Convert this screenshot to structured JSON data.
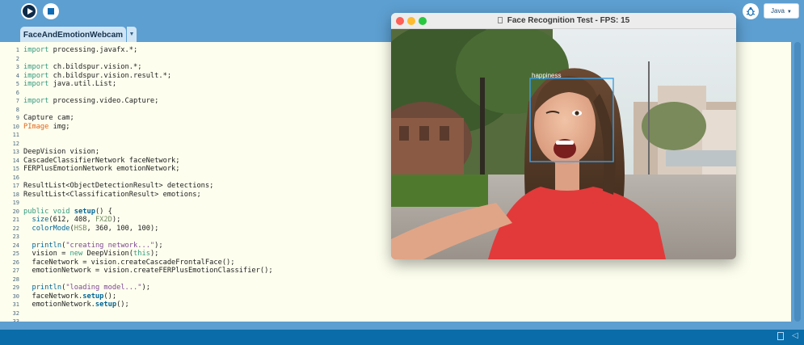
{
  "toolbar": {
    "run_icon": "play-icon",
    "stop_icon": "stop-icon",
    "debug_icon": "debugger-icon",
    "mode": "Java"
  },
  "tab": {
    "name": "FaceAndEmotionWebcam"
  },
  "editor": {
    "lines": [
      {
        "n": "1",
        "tokens": [
          {
            "t": "import",
            "c": "kw"
          },
          {
            "t": " processing.javafx.*;"
          }
        ]
      },
      {
        "n": "2",
        "tokens": []
      },
      {
        "n": "3",
        "tokens": [
          {
            "t": "import",
            "c": "kw"
          },
          {
            "t": " ch.bildspur.vision.*;"
          }
        ]
      },
      {
        "n": "4",
        "tokens": [
          {
            "t": "import",
            "c": "kw"
          },
          {
            "t": " ch.bildspur.vision.result.*;"
          }
        ]
      },
      {
        "n": "5",
        "tokens": [
          {
            "t": "import",
            "c": "kw"
          },
          {
            "t": " java.util.List;"
          }
        ]
      },
      {
        "n": "6",
        "tokens": []
      },
      {
        "n": "7",
        "tokens": [
          {
            "t": "import",
            "c": "kw"
          },
          {
            "t": " processing.video.Capture;"
          }
        ]
      },
      {
        "n": "8",
        "tokens": []
      },
      {
        "n": "9",
        "tokens": [
          {
            "t": "Capture cam;"
          }
        ]
      },
      {
        "n": "10",
        "tokens": [
          {
            "t": "PImage",
            "c": "ty"
          },
          {
            "t": " img;"
          }
        ]
      },
      {
        "n": "11",
        "tokens": []
      },
      {
        "n": "12",
        "tokens": []
      },
      {
        "n": "13",
        "tokens": [
          {
            "t": "DeepVision vision;"
          }
        ]
      },
      {
        "n": "14",
        "tokens": [
          {
            "t": "CascadeClassifierNetwork faceNetwork;"
          }
        ]
      },
      {
        "n": "15",
        "tokens": [
          {
            "t": "FERPlusEmotionNetwork emotionNetwork;"
          }
        ]
      },
      {
        "n": "16",
        "tokens": []
      },
      {
        "n": "17",
        "tokens": [
          {
            "t": "ResultList<ObjectDetectionResult> detections;"
          }
        ]
      },
      {
        "n": "18",
        "tokens": [
          {
            "t": "ResultList<ClassificationResult> emotions;"
          }
        ]
      },
      {
        "n": "19",
        "tokens": []
      },
      {
        "n": "20",
        "tokens": [
          {
            "t": "public void",
            "c": "kw"
          },
          {
            "t": " "
          },
          {
            "t": "setup",
            "c": "fn"
          },
          {
            "t": "() {"
          }
        ]
      },
      {
        "n": "21",
        "tokens": [
          {
            "t": "  "
          },
          {
            "t": "size",
            "c": "fn2"
          },
          {
            "t": "(612, 408, "
          },
          {
            "t": "FX2D",
            "c": "cst"
          },
          {
            "t": ");"
          }
        ]
      },
      {
        "n": "22",
        "tokens": [
          {
            "t": "  "
          },
          {
            "t": "colorMode",
            "c": "fn2"
          },
          {
            "t": "("
          },
          {
            "t": "HSB",
            "c": "cst"
          },
          {
            "t": ", 360, 100, 100);"
          }
        ]
      },
      {
        "n": "23",
        "tokens": []
      },
      {
        "n": "24",
        "tokens": [
          {
            "t": "  "
          },
          {
            "t": "println",
            "c": "fn2"
          },
          {
            "t": "("
          },
          {
            "t": "\"creating network...\"",
            "c": "str"
          },
          {
            "t": ");"
          }
        ]
      },
      {
        "n": "25",
        "tokens": [
          {
            "t": "  vision = "
          },
          {
            "t": "new",
            "c": "kw"
          },
          {
            "t": " DeepVision("
          },
          {
            "t": "this",
            "c": "this"
          },
          {
            "t": ");"
          }
        ]
      },
      {
        "n": "26",
        "tokens": [
          {
            "t": "  faceNetwork = vision.createCascadeFrontalFace();"
          }
        ]
      },
      {
        "n": "27",
        "tokens": [
          {
            "t": "  emotionNetwork = vision.createFERPlusEmotionClassifier();"
          }
        ]
      },
      {
        "n": "28",
        "tokens": []
      },
      {
        "n": "29",
        "tokens": [
          {
            "t": "  "
          },
          {
            "t": "println",
            "c": "fn2"
          },
          {
            "t": "("
          },
          {
            "t": "\"loading model...\"",
            "c": "str"
          },
          {
            "t": ");"
          }
        ]
      },
      {
        "n": "30",
        "tokens": [
          {
            "t": "  faceNetwork."
          },
          {
            "t": "setup",
            "c": "fn"
          },
          {
            "t": "();"
          }
        ]
      },
      {
        "n": "31",
        "tokens": [
          {
            "t": "  emotionNetwork."
          },
          {
            "t": "setup",
            "c": "fn"
          },
          {
            "t": "();"
          }
        ]
      },
      {
        "n": "32",
        "tokens": []
      },
      {
        "n": "33",
        "tokens": []
      }
    ]
  },
  "sketch_window": {
    "title": "Face Recognition Test - FPS: 15",
    "detection_label": "happiness",
    "box_color": "#3aa0e8"
  },
  "console": {
    "icons": [
      "console-icon",
      "collapse-icon"
    ]
  }
}
